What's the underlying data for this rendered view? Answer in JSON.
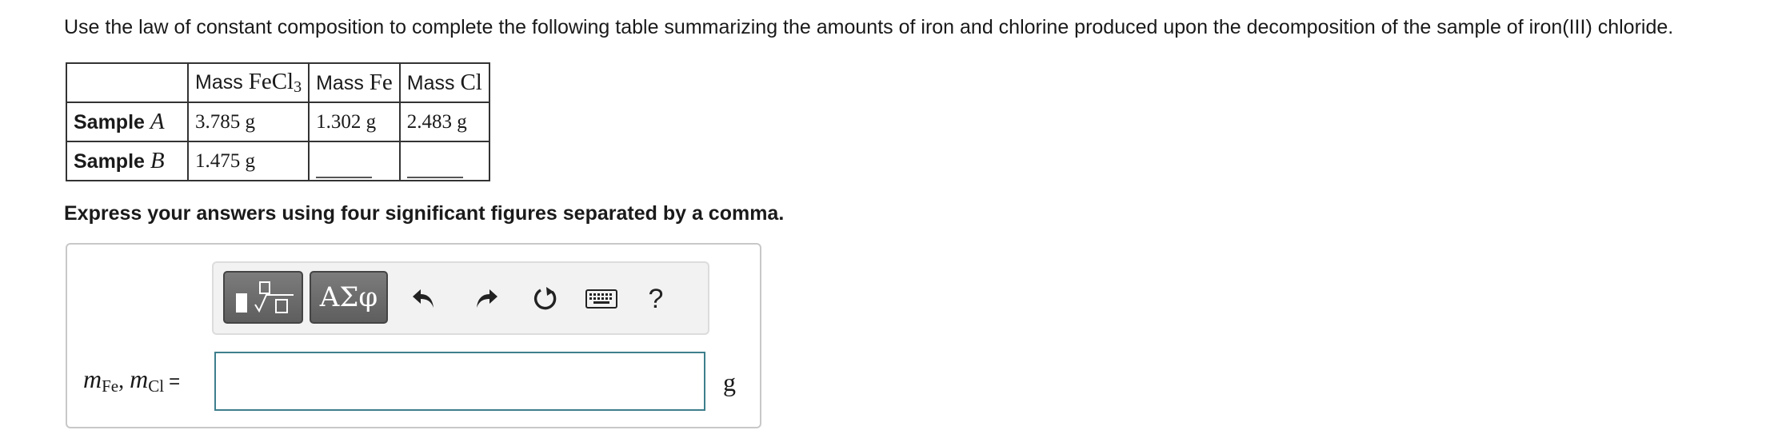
{
  "question": {
    "intro": "Use the law of constant composition to complete the following table summarizing the amounts of iron and chlorine produced upon the decomposition of the sample of iron(III) chloride.",
    "instruction": "Express your answers using four significant figures separated by a comma."
  },
  "table": {
    "headers": [
      {
        "prefix": "Mass ",
        "formula": "FeCl",
        "subscript": "3"
      },
      {
        "prefix": "Mass ",
        "formula": "Fe",
        "subscript": ""
      },
      {
        "prefix": "Mass ",
        "formula": "Cl",
        "subscript": ""
      }
    ],
    "rows": [
      {
        "label": "Sample ",
        "var": "A",
        "values": [
          "3.785 g",
          "1.302 g",
          "2.483 g"
        ]
      },
      {
        "label": "Sample ",
        "var": "B",
        "values": [
          "1.475 g",
          "",
          ""
        ]
      }
    ]
  },
  "toolbar": {
    "templates_icon": "fraction-root-template-icon",
    "symbols_label": "ΑΣφ",
    "undo_icon": "undo-icon",
    "redo_icon": "redo-icon",
    "reset_icon": "reset-icon",
    "keyboard_icon": "keyboard-icon",
    "help_label": "?"
  },
  "answer": {
    "var1": "m",
    "sub1": "Fe",
    "sep": ", ",
    "var2": "m",
    "sub2": "Cl",
    "equals": "=",
    "value": "",
    "unit": "g"
  },
  "colors": {
    "input_border": "#3e7f8d",
    "button_dark": "#6a6a6a",
    "toolbar_bg": "#f2f2f2"
  }
}
